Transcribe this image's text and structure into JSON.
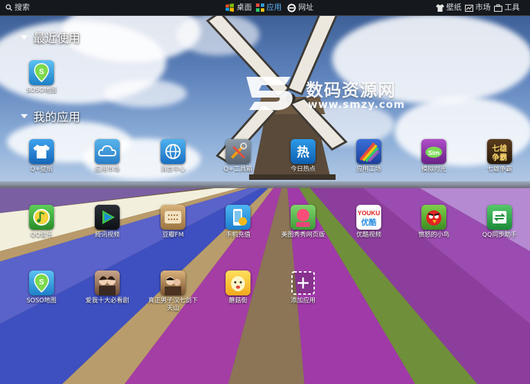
{
  "topbar": {
    "search": "搜索",
    "desktop": "桌面",
    "apps": "应用",
    "web": "网址",
    "wallpaper": "壁纸",
    "market": "市场",
    "tools": "工具"
  },
  "sections": {
    "recent": "最近使用",
    "my_apps": "我的应用"
  },
  "recent_apps": [
    {
      "label": "SOSO地图",
      "icon": "soso-map-icon"
    }
  ],
  "my_apps": [
    {
      "label": "Q+壁纸",
      "icon": "shirt-icon"
    },
    {
      "label": "应用市场",
      "icon": "cloud-icon"
    },
    {
      "label": "消息中心",
      "icon": "globe-icon"
    },
    {
      "label": "Q+工具箱",
      "icon": "toolbox-icon"
    },
    {
      "label": "今日热点",
      "icon": "hot-news-icon"
    },
    {
      "label": "应用工场",
      "icon": "rainbow-icon"
    },
    {
      "label": "模拟时光",
      "icon": "game-icon"
    },
    {
      "label": "七雄争霸",
      "icon": "strategy-game-icon"
    },
    {
      "label": "QQ音乐",
      "icon": "music-icon"
    },
    {
      "label": "腾讯视频",
      "icon": "video-play-icon"
    },
    {
      "label": "豆瓣FM",
      "icon": "radio-icon"
    },
    {
      "label": "手机充值",
      "icon": "phone-recharge-icon"
    },
    {
      "label": "美图秀秀网页版",
      "icon": "meitu-icon"
    },
    {
      "label": "优酷视频",
      "icon": "youku-icon"
    },
    {
      "label": "愤怒的小鸟",
      "icon": "angry-bird-icon"
    },
    {
      "label": "QQ同步助手",
      "icon": "sync-icon"
    },
    {
      "label": "SOSO地图",
      "icon": "soso-map-icon"
    },
    {
      "label": "爱我十大必看剧",
      "icon": "drama-icon"
    },
    {
      "label": "真正男子汉七剑下天山",
      "icon": "movie-icon"
    },
    {
      "label": "蘑菇街",
      "icon": "mogujie-icon"
    },
    {
      "label": "添加应用",
      "icon": "add-icon"
    }
  ],
  "watermark": {
    "title": "数码资源网",
    "url": "www.smzy.com"
  },
  "colors": {
    "topbar_bg": "#15181c",
    "active": "#5fb6ff"
  }
}
